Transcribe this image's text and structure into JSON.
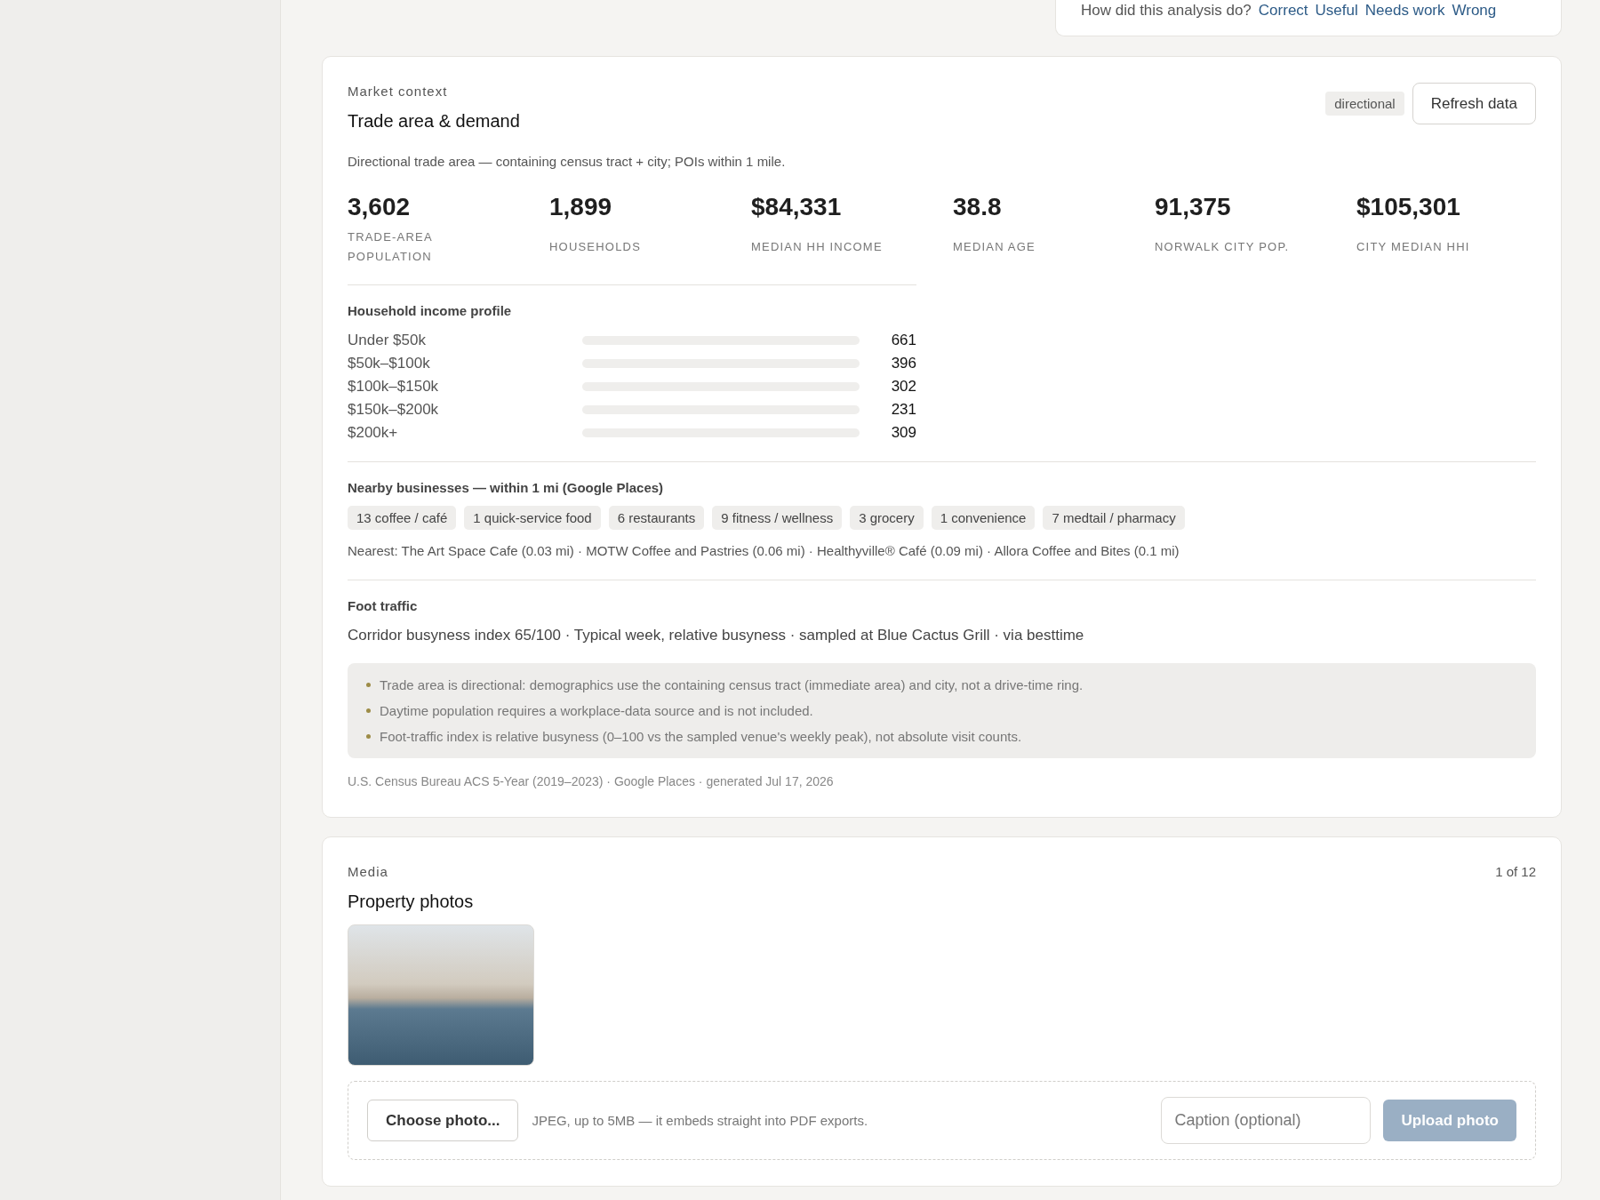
{
  "feedback": {
    "question": "How did this analysis do?",
    "options": [
      "Correct",
      "Useful",
      "Needs work",
      "Wrong"
    ]
  },
  "market_card": {
    "eyebrow": "Market context",
    "title": "Trade area & demand",
    "badge": "directional",
    "refresh_button": "Refresh data",
    "description": "Directional trade area — containing census tract + city; POIs within 1 mile.",
    "stats": [
      {
        "value": "3,602",
        "label": "TRADE-AREA POPULATION"
      },
      {
        "value": "1,899",
        "label": "HOUSEHOLDS"
      },
      {
        "value": "$84,331",
        "label": "MEDIAN HH INCOME"
      },
      {
        "value": "38.8",
        "label": "MEDIAN AGE"
      },
      {
        "value": "91,375",
        "label": "NORWALK CITY POP."
      },
      {
        "value": "$105,301",
        "label": "CITY MEDIAN HHI"
      }
    ],
    "income_profile": {
      "title": "Household income profile",
      "rows": [
        {
          "label": "Under $50k",
          "count": "661"
        },
        {
          "label": "$50k–$100k",
          "count": "396"
        },
        {
          "label": "$100k–$150k",
          "count": "302"
        },
        {
          "label": "$150k–$200k",
          "count": "231"
        },
        {
          "label": "$200k+",
          "count": "309"
        }
      ]
    },
    "nearby": {
      "title": "Nearby businesses — within 1 mi (Google Places)",
      "chips": [
        "13 coffee / café",
        "1 quick-service food",
        "6 restaurants",
        "9 fitness / wellness",
        "3 grocery",
        "1 convenience",
        "7 medtail / pharmacy"
      ],
      "nearest": "Nearest: The Art Space Cafe (0.03 mi) · MOTW Coffee and Pastries (0.06 mi) · Healthyville® Café (0.09 mi) · Allora Coffee and Bites (0.1 mi)"
    },
    "foot_traffic": {
      "title": "Foot traffic",
      "summary": "Corridor busyness index 65/100 · Typical week, relative busyness · sampled at Blue Cactus Grill · via besttime"
    },
    "notes": [
      "Trade area is directional: demographics use the containing census tract (immediate area) and city, not a drive-time ring.",
      "Daytime population requires a workplace-data source and is not included.",
      "Foot-traffic index is relative busyness (0–100 vs the sampled venue's weekly peak), not absolute visit counts."
    ],
    "sources": "U.S. Census Bureau ACS 5-Year (2019–2023) · Google Places · generated Jul 17, 2026"
  },
  "media_card": {
    "eyebrow": "Media",
    "title": "Property photos",
    "counter": "1 of 12",
    "photos": [
      {
        "kind": "photo"
      }
    ],
    "upload": {
      "choose_button": "Choose photo...",
      "hint": "JPEG, up to 5MB — it embeds straight into PDF exports.",
      "caption": {
        "placeholder": "Caption (optional)"
      },
      "upload_button": {
        "label": "Upload photo",
        "disabled": true
      }
    }
  }
}
